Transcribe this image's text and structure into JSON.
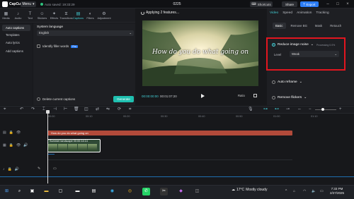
{
  "titlebar": {
    "app_name": "CapCut",
    "menu_label": "Menu",
    "autosave": "Auto saved: 19:33:29",
    "project_title": "0225",
    "shortcuts_label": "Shortcuts",
    "share_label": "Share",
    "export_label": "Export"
  },
  "toolbar": {
    "tools": [
      {
        "label": "Media",
        "icon": "media-icon"
      },
      {
        "label": "Audio",
        "icon": "audio-icon"
      },
      {
        "label": "Text",
        "icon": "text-icon"
      },
      {
        "label": "Stickers",
        "icon": "stickers-icon"
      },
      {
        "label": "Effects",
        "icon": "effects-icon"
      },
      {
        "label": "Transitions",
        "icon": "transitions-icon"
      },
      {
        "label": "Captions",
        "icon": "captions-icon"
      },
      {
        "label": "Filters",
        "icon": "filters-icon"
      },
      {
        "label": "Adjustment",
        "icon": "adjustment-icon"
      }
    ],
    "active": "Captions"
  },
  "leftnav": {
    "items": [
      "Auto captions",
      "Templates",
      "Auto lyrics",
      "Add captions"
    ]
  },
  "captions_panel": {
    "system_language_label": "System language",
    "language_value": "English",
    "filler_label": "Identify filler words",
    "pro_badge": "Pro",
    "delete_label": "Delete current captions",
    "generate_label": "Generate"
  },
  "player": {
    "status": "Applying 2 features...",
    "caption_text": "How do you do what going on",
    "current_time": "00:00:00:00",
    "total_time": "00:01:07:20",
    "ratio_label": "Ratio"
  },
  "right_panel": {
    "tabs": [
      "Video",
      "Speed",
      "Animation",
      "Tracking"
    ],
    "active_tab": "Video",
    "subtabs": [
      "Basic",
      "Remove BG",
      "Mask",
      "Retouch"
    ],
    "active_subtab": "Basic",
    "reduce_noise_label": "Reduce image noise",
    "processing_label": "Processing 0.0%",
    "level_label": "Level",
    "level_value": "Weak",
    "auto_reframe_label": "Auto reframe",
    "remove_flickers_label": "Remove flickers"
  },
  "timeline": {
    "ruler": [
      "00:00",
      "00:10",
      "00:20",
      "00:30",
      "00:40",
      "00:50",
      "01:00",
      "01:10"
    ],
    "caption_clip": "How do you do what going on",
    "video_clip_label": "Summer landscape",
    "video_clip_duration": "00:00:14:14",
    "cover_label": "Cover"
  },
  "taskbar": {
    "temperature": "17°C",
    "weather": "Mostly cloudy",
    "time": "7:33 PM",
    "date": "2/27/2025"
  },
  "colors": {
    "accent": "#43d0d7",
    "export_blue": "#2a7cf5",
    "highlight_red": "#e2161f",
    "caption_clip": "#b24a3a"
  }
}
